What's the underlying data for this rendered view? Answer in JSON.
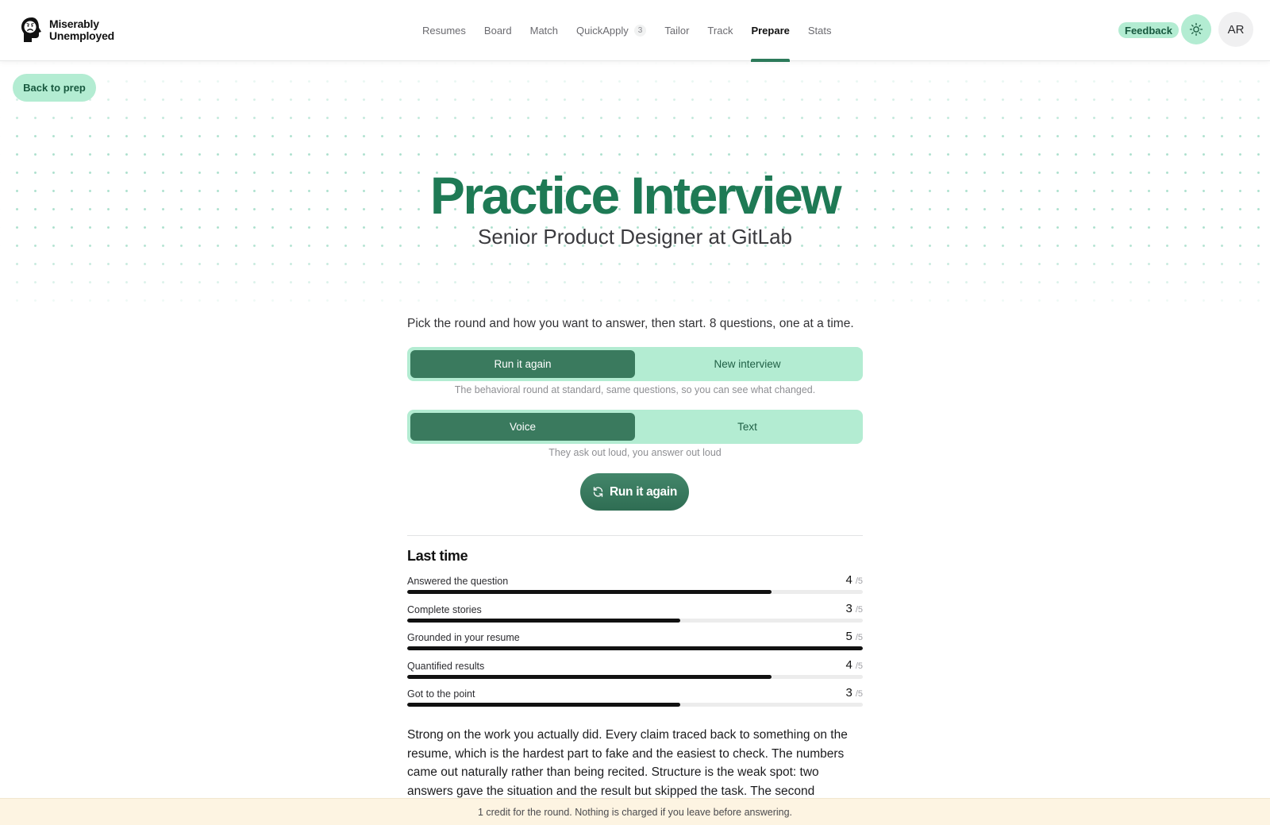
{
  "brand": {
    "line1": "Miserably",
    "line2": "Unemployed"
  },
  "nav": {
    "items": [
      {
        "label": "Resumes"
      },
      {
        "label": "Board"
      },
      {
        "label": "Match"
      },
      {
        "label": "QuickApply",
        "badge": "3"
      },
      {
        "label": "Tailor"
      },
      {
        "label": "Track"
      },
      {
        "label": "Prepare",
        "active": true
      },
      {
        "label": "Stats"
      }
    ],
    "feedback_label": "Feedback",
    "theme_icon": "sun-icon",
    "avatar_initials": "AR"
  },
  "back_label": "Back to prep",
  "hero": {
    "title": "Practice Interview",
    "subtitle": "Senior Product Designer at GitLab"
  },
  "setup": {
    "intro": "Pick the round and how you want to answer, then start. 8 questions, one at a time.",
    "round_options": [
      "Run it again",
      "New interview"
    ],
    "round_selected": "Run it again",
    "round_hint": "The behavioral round at standard, same questions, so you can see what changed.",
    "mode_options": [
      "Voice",
      "Text"
    ],
    "mode_selected": "Voice",
    "mode_hint": "They ask out loud, you answer out loud",
    "start_label": "Run it again",
    "start_icon": "refresh-icon"
  },
  "last_time": {
    "title": "Last time",
    "max_suffix": "/5",
    "scores": [
      {
        "label": "Answered the question",
        "value": 4,
        "max": 5
      },
      {
        "label": "Complete stories",
        "value": 3,
        "max": 5
      },
      {
        "label": "Grounded in your resume",
        "value": 5,
        "max": 5
      },
      {
        "label": "Quantified results",
        "value": 4,
        "max": 5
      },
      {
        "label": "Got to the point",
        "value": 3,
        "max": 5
      }
    ],
    "summary": "Strong on the work you actually did. Every claim traced back to something on the resume, which is the hardest part to fake and the easiest to check. The numbers came out naturally rather than being recited. Structure is the weak spot: two answers gave the situation and the result but skipped the task. The second"
  },
  "notice": "1 credit for the round. Nothing is charged if you leave before answering.",
  "colors": {
    "accent": "#1e7a55",
    "accent_dark": "#3a7a5e",
    "mint": "#b3ecd2",
    "notice_bg": "#fdf4e2"
  }
}
